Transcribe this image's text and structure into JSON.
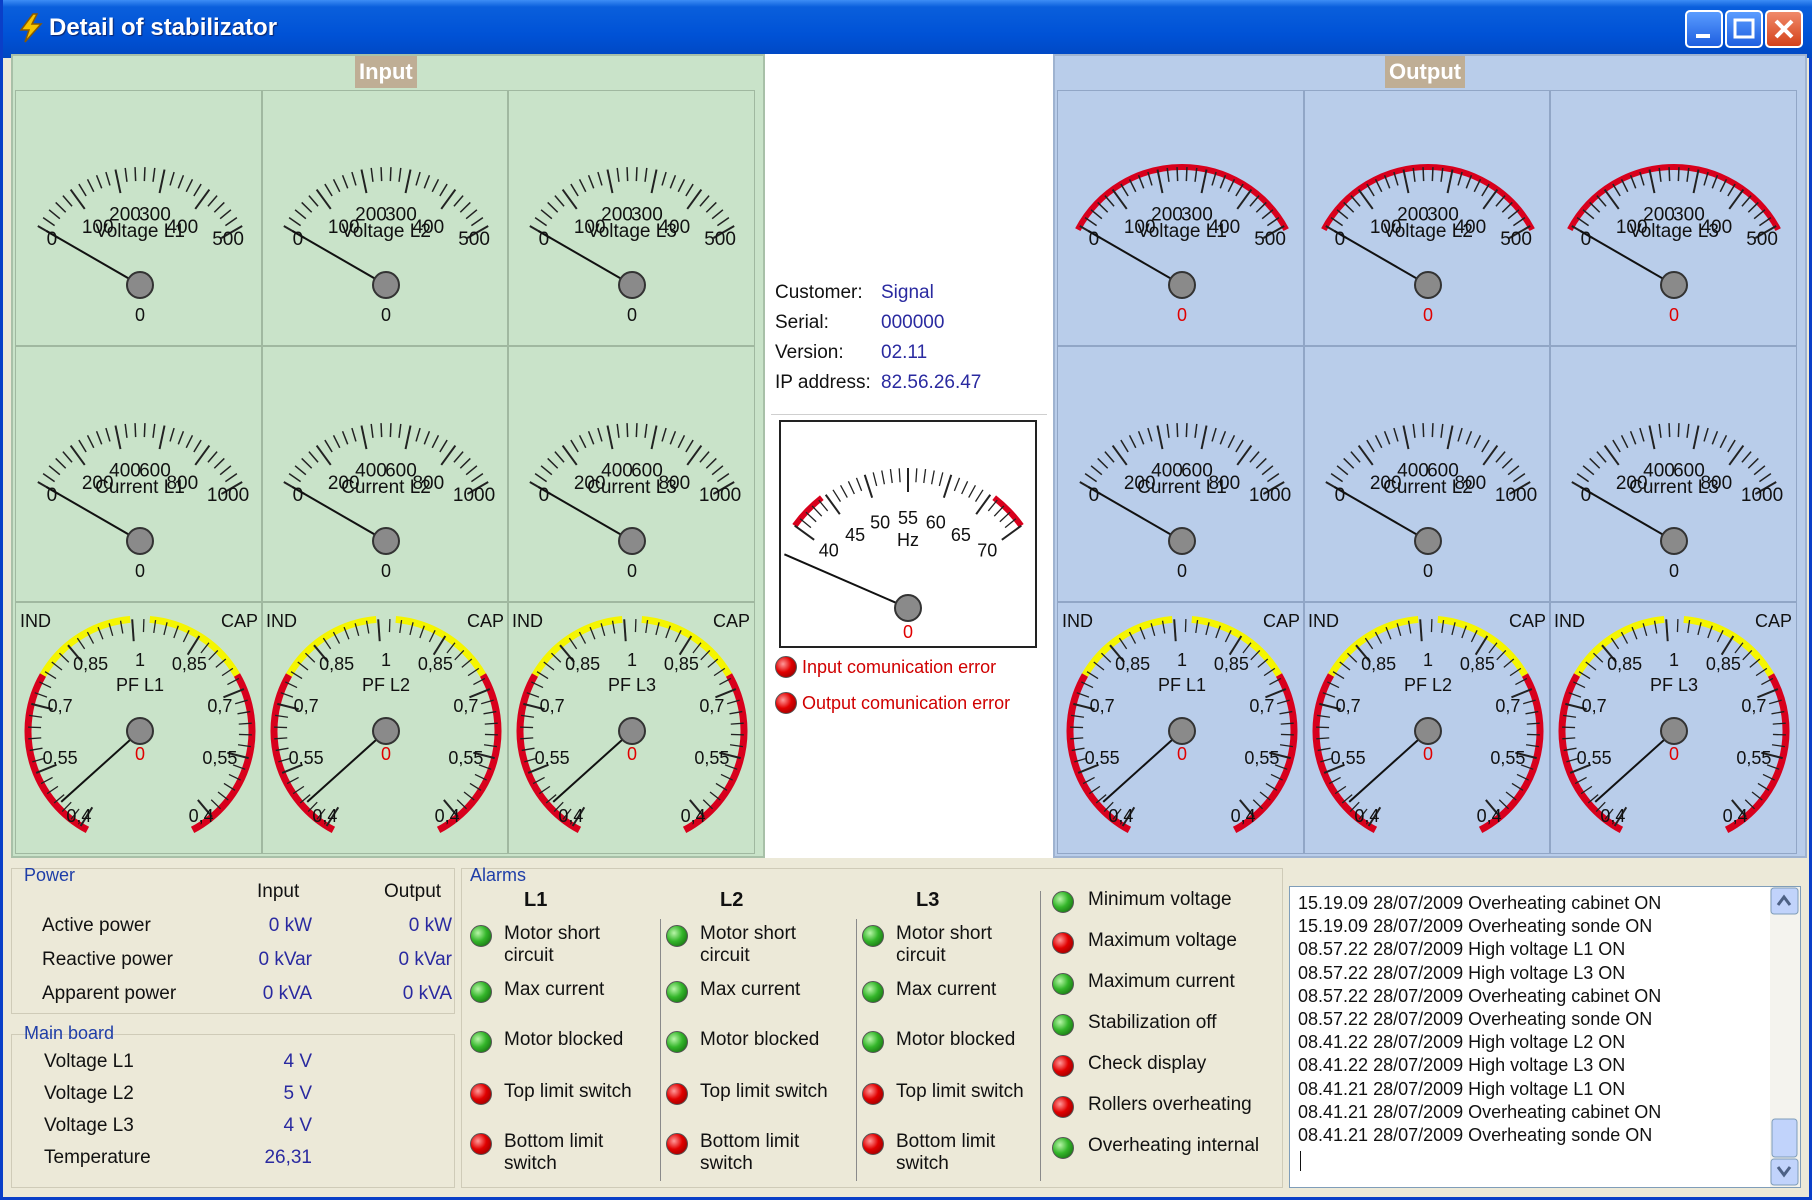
{
  "window": {
    "title": "Detail of stabilizator"
  },
  "input_panel": {
    "title": "Input",
    "voltage": [
      {
        "label": "Voltage L1",
        "value": "0"
      },
      {
        "label": "Voltage L2",
        "value": "0"
      },
      {
        "label": "Voltage L3",
        "value": "0"
      }
    ],
    "current": [
      {
        "label": "Current L1",
        "value": "0"
      },
      {
        "label": "Current L2",
        "value": "0"
      },
      {
        "label": "Current L3",
        "value": "0"
      }
    ],
    "pf": [
      {
        "label": "PF L1",
        "value": "0"
      },
      {
        "label": "PF L2",
        "value": "0"
      },
      {
        "label": "PF L3",
        "value": "0"
      }
    ]
  },
  "output_panel": {
    "title": "Output",
    "voltage": [
      {
        "label": "Voltage L1",
        "value": "0"
      },
      {
        "label": "Voltage L2",
        "value": "0"
      },
      {
        "label": "Voltage L3",
        "value": "0"
      }
    ],
    "current": [
      {
        "label": "Current L1",
        "value": "0"
      },
      {
        "label": "Current L2",
        "value": "0"
      },
      {
        "label": "Current L3",
        "value": "0"
      }
    ],
    "pf": [
      {
        "label": "PF L1",
        "value": "0"
      },
      {
        "label": "PF L2",
        "value": "0"
      },
      {
        "label": "PF L3",
        "value": "0"
      }
    ]
  },
  "scales": {
    "voltage": [
      "0",
      "100",
      "200",
      "300",
      "400",
      "500"
    ],
    "current": [
      "0",
      "200",
      "400",
      "600",
      "800",
      "1000"
    ],
    "pf_left": [
      "0,4",
      "0,55",
      "0,7",
      "0,85"
    ],
    "pf_center": "1",
    "pf_right": [
      "0,85",
      "0,7",
      "0,55",
      "0,4"
    ],
    "pf_ind": "IND",
    "pf_cap": "CAP",
    "freq": [
      "40",
      "45",
      "50",
      "55",
      "60",
      "65",
      "70"
    ],
    "freq_unit": "Hz"
  },
  "device_info": {
    "customer_label": "Customer:",
    "customer": "Signal",
    "serial_label": "Serial:",
    "serial": "000000",
    "version_label": "Version:",
    "version": "02.11",
    "ip_label": "IP address:",
    "ip": "82.56.26.47"
  },
  "frequency": {
    "value": "0"
  },
  "errors": [
    "Input comunication error",
    "Output comunication error"
  ],
  "power": {
    "title": "Power",
    "col_input": "Input",
    "col_output": "Output",
    "rows": [
      {
        "label": "Active power",
        "input": "0 kW",
        "output": "0 kW"
      },
      {
        "label": "Reactive power",
        "input": "0 kVar",
        "output": "0 kVar"
      },
      {
        "label": "Apparent power",
        "input": "0 kVA",
        "output": "0 kVA"
      }
    ]
  },
  "main_board": {
    "title": "Main board",
    "rows": [
      {
        "label": "Voltage L1",
        "value": "4 V"
      },
      {
        "label": "Voltage L2",
        "value": "5 V"
      },
      {
        "label": "Voltage L3",
        "value": "4 V"
      },
      {
        "label": "Temperature",
        "value": "26,31"
      }
    ]
  },
  "alarms": {
    "title": "Alarms",
    "phases": [
      {
        "name": "L1",
        "items": [
          {
            "label": "Motor short circuit",
            "status": "green"
          },
          {
            "label": "Max current",
            "status": "green"
          },
          {
            "label": "Motor blocked",
            "status": "green"
          },
          {
            "label": "Top limit switch",
            "status": "red"
          },
          {
            "label": "Bottom limit switch",
            "status": "red"
          }
        ]
      },
      {
        "name": "L2",
        "items": [
          {
            "label": "Motor short circuit",
            "status": "green"
          },
          {
            "label": "Max current",
            "status": "green"
          },
          {
            "label": "Motor blocked",
            "status": "green"
          },
          {
            "label": "Top limit switch",
            "status": "red"
          },
          {
            "label": "Bottom limit switch",
            "status": "red"
          }
        ]
      },
      {
        "name": "L3",
        "items": [
          {
            "label": "Motor short circuit",
            "status": "green"
          },
          {
            "label": "Max  current",
            "status": "green"
          },
          {
            "label": "Motor blocked",
            "status": "green"
          },
          {
            "label": "Top limit switch",
            "status": "red"
          },
          {
            "label": "Bottom limit switch",
            "status": "red"
          }
        ]
      }
    ],
    "general": [
      {
        "label": "Minimum voltage",
        "status": "green"
      },
      {
        "label": "Maximum voltage",
        "status": "red"
      },
      {
        "label": "Maximum current",
        "status": "green"
      },
      {
        "label": "Stabilization off",
        "status": "green"
      },
      {
        "label": "Check display",
        "status": "red"
      },
      {
        "label": "Rollers overheating",
        "status": "red"
      },
      {
        "label": "Overheating internal",
        "status": "green"
      }
    ]
  },
  "log": [
    "15.19.09 28/07/2009 Overheating cabinet ON",
    "15.19.09 28/07/2009 Overheating sonde ON",
    "08.57.22 28/07/2009 High voltage L1 ON",
    "08.57.22 28/07/2009 High voltage L3 ON",
    "08.57.22 28/07/2009 Overheating cabinet ON",
    "08.57.22 28/07/2009 Overheating sonde ON",
    "08.41.22 28/07/2009 High voltage L2 ON",
    "08.41.22 28/07/2009 High voltage L3 ON",
    "08.41.21 28/07/2009 High voltage L1 ON",
    "08.41.21 28/07/2009 Overheating cabinet ON",
    "08.41.21 28/07/2009 Overheating sonde ON"
  ],
  "colors": {
    "alarm_red": "#e20000",
    "ok_green": "#34b62a",
    "scale_red": "#d8001c",
    "scale_yellow": "#f5f500",
    "input_bg": "#c9e3c9",
    "output_bg": "#b9cdea"
  }
}
